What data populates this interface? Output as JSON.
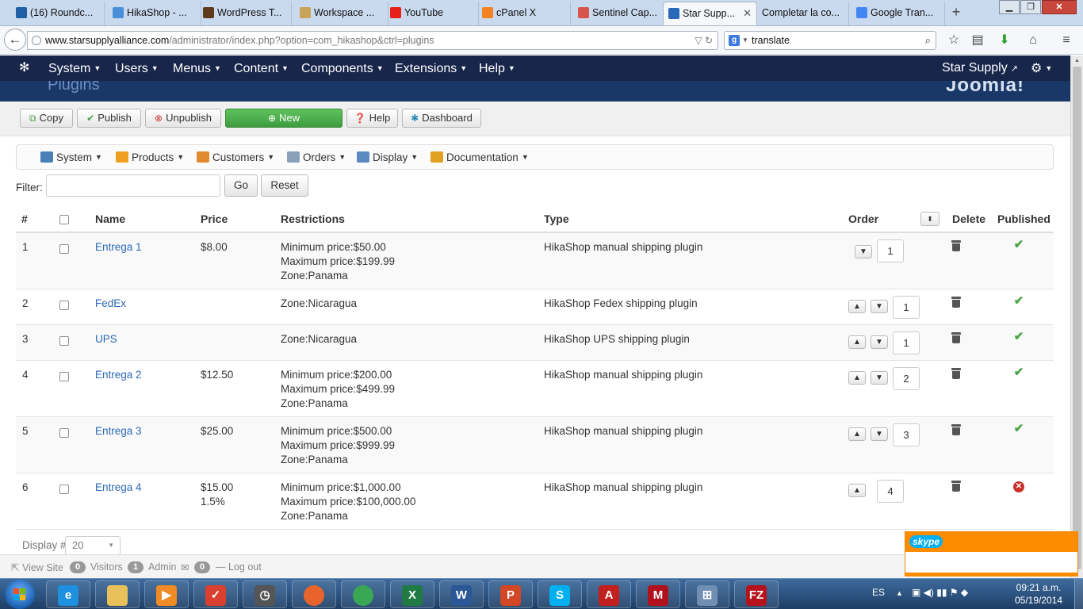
{
  "browser": {
    "tabs": [
      {
        "label": "(16) Roundc...",
        "icon_color": "#1f5fa6"
      },
      {
        "label": "HikaShop - ...",
        "icon_color": "#4a90d9"
      },
      {
        "label": "WordPress T...",
        "icon_color": "#5c3a1a"
      },
      {
        "label": "Workspace ...",
        "icon_color": "#c8a45a"
      },
      {
        "label": "YouTube",
        "icon_color": "#e62117"
      },
      {
        "label": "cPanel X",
        "icon_color": "#f58220"
      },
      {
        "label": "Sentinel Cap...",
        "icon_color": "#d9534f"
      },
      {
        "label": "Star Supp...",
        "icon_color": "#2a69b8",
        "active": true
      },
      {
        "label": "Completar la co...",
        "icon_color": null
      },
      {
        "label": "Google Tran...",
        "icon_color": "#4285f4"
      }
    ],
    "new_tab": "+",
    "url_domain": "www.starsupplyalliance.com",
    "url_path": "/administrator/index.php?option=com_hikashop&ctrl=plugins",
    "search_value": "translate",
    "search_engine_letter": "g"
  },
  "joomla": {
    "menu": [
      {
        "label": "System"
      },
      {
        "label": "Users"
      },
      {
        "label": "Menus"
      },
      {
        "label": "Content"
      },
      {
        "label": "Components"
      },
      {
        "label": "Extensions"
      },
      {
        "label": "Help"
      }
    ],
    "site_link": "Star Supply",
    "page_title": "Plugins",
    "brand": "Joomla!"
  },
  "toolbar": {
    "copy": "Copy",
    "publish": "Publish",
    "unpublish": "Unpublish",
    "new": "New",
    "help": "Help",
    "dashboard": "Dashboard"
  },
  "submenu": [
    {
      "label": "System",
      "icon_color": "#4a7fb8"
    },
    {
      "label": "Products",
      "icon_color": "#f0a020"
    },
    {
      "label": "Customers",
      "icon_color": "#e08a30"
    },
    {
      "label": "Orders",
      "icon_color": "#8a9fb8"
    },
    {
      "label": "Display",
      "icon_color": "#5a8ac0"
    },
    {
      "label": "Documentation",
      "icon_color": "#e0a020"
    }
  ],
  "filter": {
    "label": "Filter:",
    "value": "",
    "go": "Go",
    "reset": "Reset"
  },
  "table": {
    "headers": {
      "num": "#",
      "name": "Name",
      "price": "Price",
      "restrictions": "Restrictions",
      "type": "Type",
      "order": "Order",
      "delete": "Delete",
      "published": "Published"
    },
    "rows": [
      {
        "num": "1",
        "name": "Entrega 1",
        "price": "$8.00",
        "price2": "",
        "restr": [
          "Minimum price:$50.00",
          "Maximum price:$199.99",
          "Zone:Panama"
        ],
        "type": "HikaShop manual shipping plugin",
        "order": "1",
        "up": false,
        "down": true,
        "published": true
      },
      {
        "num": "2",
        "name": "FedEx",
        "price": "",
        "price2": "",
        "restr": [
          "Zone:Nicaragua"
        ],
        "type": "HikaShop Fedex shipping plugin",
        "order": "1",
        "up": true,
        "down": true,
        "published": true
      },
      {
        "num": "3",
        "name": "UPS",
        "price": "",
        "price2": "",
        "restr": [
          "Zone:Nicaragua"
        ],
        "type": "HikaShop UPS shipping plugin",
        "order": "1",
        "up": true,
        "down": true,
        "published": true
      },
      {
        "num": "4",
        "name": "Entrega 2",
        "price": "$12.50",
        "price2": "",
        "restr": [
          "Minimum price:$200.00",
          "Maximum price:$499.99",
          "Zone:Panama"
        ],
        "type": "HikaShop manual shipping plugin",
        "order": "2",
        "up": true,
        "down": true,
        "published": true
      },
      {
        "num": "5",
        "name": "Entrega 3",
        "price": "$25.00",
        "price2": "",
        "restr": [
          "Minimum price:$500.00",
          "Maximum price:$999.99",
          "Zone:Panama"
        ],
        "type": "HikaShop manual shipping plugin",
        "order": "3",
        "up": true,
        "down": true,
        "published": true
      },
      {
        "num": "6",
        "name": "Entrega 4",
        "price": "$15.00",
        "price2": "1.5%",
        "restr": [
          "Minimum price:$1,000.00",
          "Maximum price:$100,000.00",
          "Zone:Panama"
        ],
        "type": "HikaShop manual shipping plugin",
        "order": "4",
        "up": true,
        "down": false,
        "published": false
      }
    ]
  },
  "display": {
    "label": "Display #",
    "value": "20"
  },
  "statusbar": {
    "view_site": "View Site",
    "visitors_count": "0",
    "visitors": "Visitors",
    "admin_count": "1",
    "admin": "Admin",
    "messages_count": "0",
    "logout": "Log out"
  },
  "skype": {
    "logo": "skype"
  },
  "taskbar": {
    "apps": [
      {
        "name": "internet-explorer",
        "letter": "e",
        "color": "#1e90e0"
      },
      {
        "name": "file-explorer",
        "letter": "",
        "color": "#e8c15a"
      },
      {
        "name": "media-player",
        "letter": "▶",
        "color": "#f08a24"
      },
      {
        "name": "todoist",
        "letter": "✓",
        "color": "#d9402f"
      },
      {
        "name": "clock-app",
        "letter": "◷",
        "color": "#555555"
      },
      {
        "name": "firefox",
        "letter": "",
        "color": "#e8642a"
      },
      {
        "name": "chrome",
        "letter": "",
        "color": "#3aa757"
      },
      {
        "name": "excel",
        "letter": "X",
        "color": "#1f7a43"
      },
      {
        "name": "word",
        "letter": "W",
        "color": "#2b5797"
      },
      {
        "name": "powerpoint",
        "letter": "P",
        "color": "#d24726"
      },
      {
        "name": "skype",
        "letter": "S",
        "color": "#00aff0"
      },
      {
        "name": "acrobat",
        "letter": "A",
        "color": "#c21f1f"
      },
      {
        "name": "mcafee",
        "letter": "M",
        "color": "#b0111d"
      },
      {
        "name": "calculator",
        "letter": "⊞",
        "color": "#6f8fb3"
      },
      {
        "name": "filezilla",
        "letter": "FZ",
        "color": "#b5121b"
      }
    ],
    "language": "ES",
    "time": "09:21 a.m.",
    "date": "05/19/2014"
  }
}
